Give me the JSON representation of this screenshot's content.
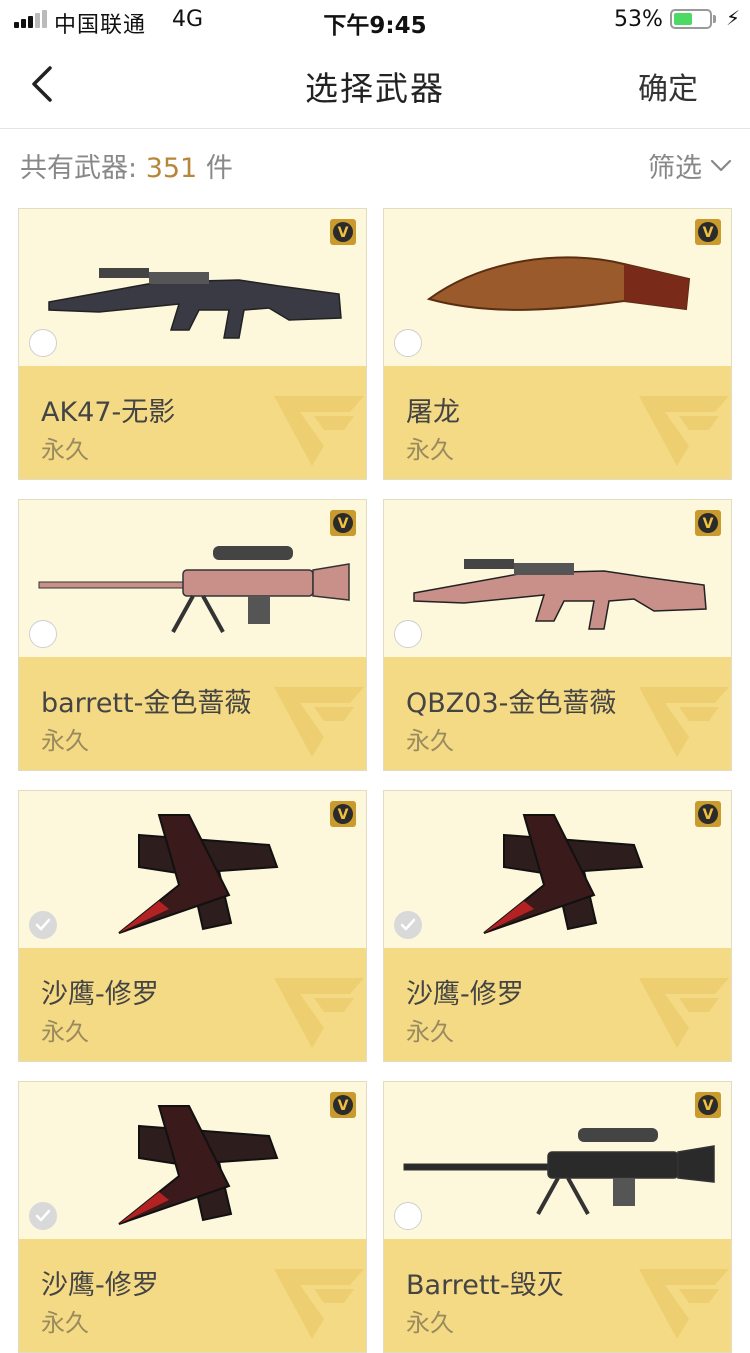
{
  "status_bar": {
    "carrier": "中国联通",
    "network": "4G",
    "time": "下午9:45",
    "battery_percent": "53%",
    "battery_level": 0.53
  },
  "nav": {
    "back_icon": "chevron-left-icon",
    "title": "选择武器",
    "confirm_label": "确定"
  },
  "summary": {
    "label": "共有武器: ",
    "count": "351",
    "unit": " 件"
  },
  "filter": {
    "label": "筛选",
    "icon": "chevron-down-icon"
  },
  "colors": {
    "card_top_bg": "#fdf7dc",
    "card_bottom_bg": "#f5da85",
    "count_accent": "#b8863b",
    "battery_green": "#4cd964"
  },
  "weapons": [
    {
      "name": "AK47-无影",
      "duration": "永久",
      "selected": false,
      "icon": "rifle-icon"
    },
    {
      "name": "屠龙",
      "duration": "永久",
      "selected": false,
      "icon": "knife-icon"
    },
    {
      "name": "barrett-金色蔷薇",
      "duration": "永久",
      "selected": false,
      "icon": "sniper-rifle-icon"
    },
    {
      "name": "QBZ03-金色蔷薇",
      "duration": "永久",
      "selected": false,
      "icon": "rifle-icon"
    },
    {
      "name": "沙鹰-修罗",
      "duration": "永久",
      "selected": true,
      "icon": "pistol-icon"
    },
    {
      "name": "沙鹰-修罗",
      "duration": "永久",
      "selected": true,
      "icon": "pistol-icon"
    },
    {
      "name": "沙鹰-修罗",
      "duration": "永久",
      "selected": true,
      "icon": "pistol-icon"
    },
    {
      "name": "Barrett-毁灭",
      "duration": "永久",
      "selected": false,
      "icon": "sniper-rifle-icon"
    }
  ]
}
